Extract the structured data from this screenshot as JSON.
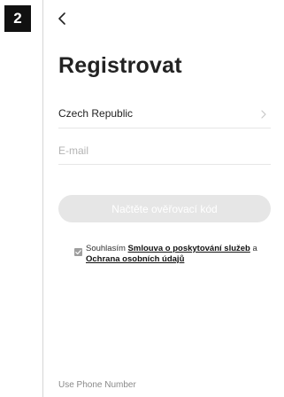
{
  "step_badge": "2",
  "header": {
    "back_icon": "chevron-left-icon"
  },
  "page_title": "Registrovat",
  "country": {
    "label": "Czech Republic",
    "icon": "chevron-right-icon"
  },
  "email": {
    "value": "",
    "placeholder": "E-mail"
  },
  "code_button": {
    "label": "Načtěte ověřovací kód",
    "state": "disabled"
  },
  "consent": {
    "checked": true,
    "prefix": "Souhlasím ",
    "link_terms": "Smlouva o poskytování služeb",
    "joiner": " a",
    "link_privacy": "Ochrana osobních údajů"
  },
  "footer": {
    "use_phone_label": "Use Phone Number"
  },
  "colors": {
    "badge_bg": "#111111",
    "button_bg_disabled": "#e6e6e6",
    "checkbox": "#9e9e9e",
    "muted_text": "#8a8a8a"
  }
}
